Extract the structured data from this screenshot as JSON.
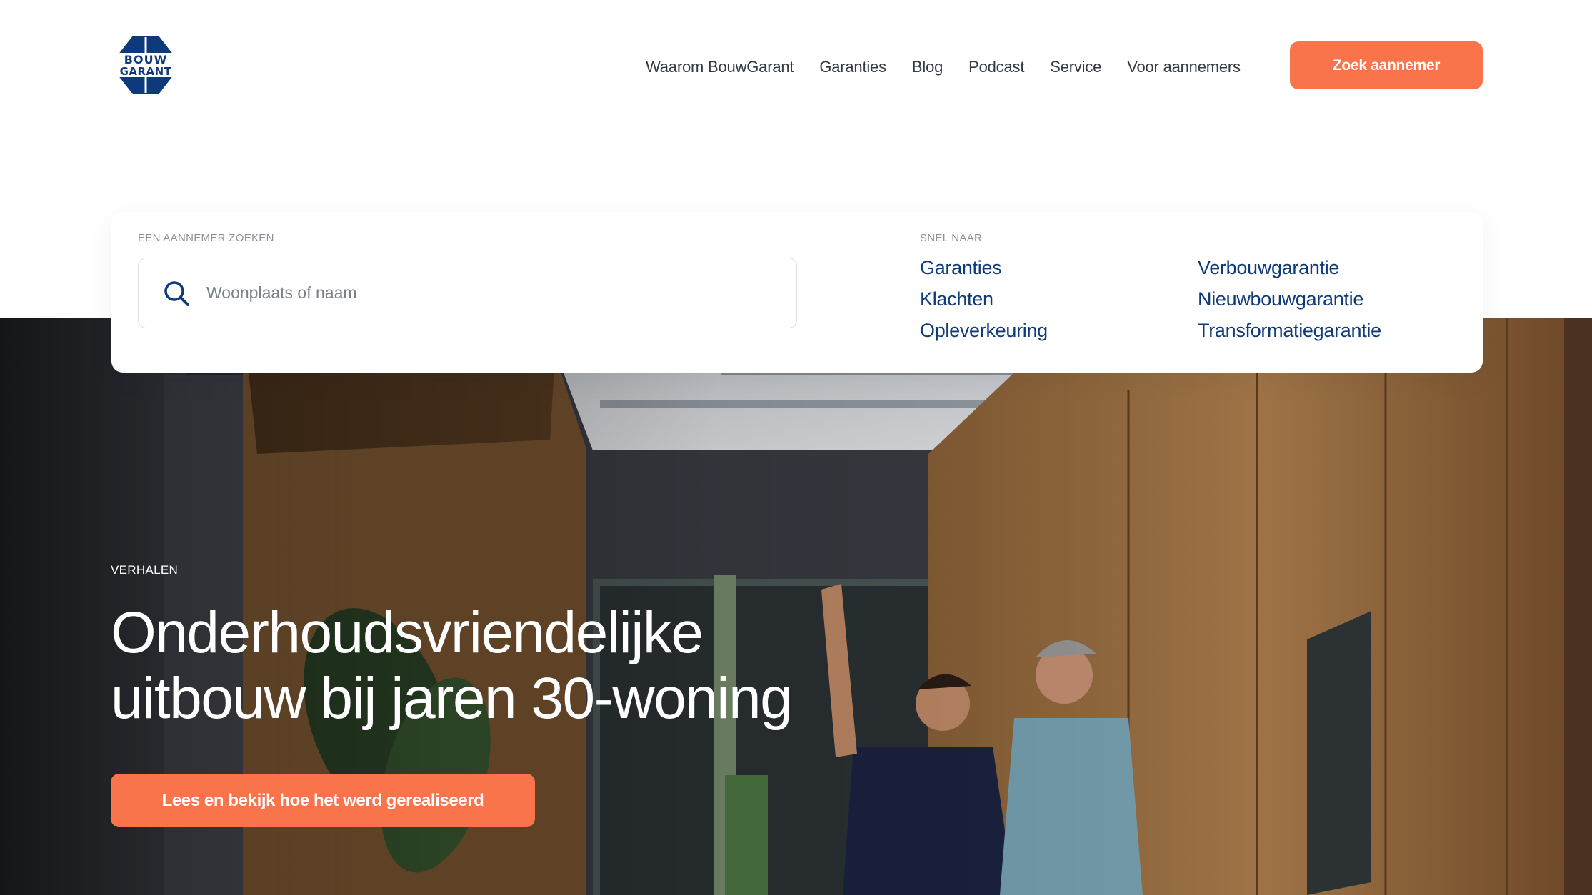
{
  "brand": {
    "logo_line1": "BOUW",
    "logo_line2": "GARANT",
    "primary_color": "#0e3a7c",
    "accent_color": "#f9734b"
  },
  "nav": {
    "items": [
      {
        "label": "Waarom BouwGarant"
      },
      {
        "label": "Garanties"
      },
      {
        "label": "Blog"
      },
      {
        "label": "Podcast"
      },
      {
        "label": "Service"
      },
      {
        "label": "Voor aannemers"
      }
    ],
    "cta_label": "Zoek aannemer"
  },
  "search": {
    "label": "EEN AANNEMER ZOEKEN",
    "placeholder": "Woonplaats of naam",
    "value": "",
    "icon": "search-icon"
  },
  "quick_links": {
    "label": "SNEL NAAR",
    "items": [
      {
        "label": "Garanties"
      },
      {
        "label": "Verbouwgarantie"
      },
      {
        "label": "Klachten"
      },
      {
        "label": "Nieuwbouwgarantie"
      },
      {
        "label": "Opleverkeuring"
      },
      {
        "label": "Transformatiegarantie"
      }
    ]
  },
  "hero": {
    "eyebrow": "VERHALEN",
    "title_line1": "Onderhoudsvriendelijke",
    "title_line2": "uitbouw bij jaren 30-woning",
    "cta_label": "Lees en bekijk hoe het werd gerealiseerd"
  }
}
